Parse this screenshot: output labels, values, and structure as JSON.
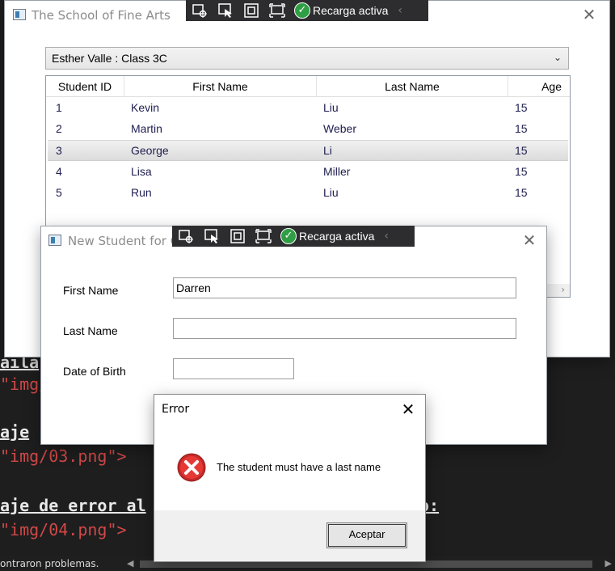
{
  "background_editor": {
    "lines": [
      {
        "text": "aila",
        "kind": "heading"
      },
      {
        "text": "\"img/",
        "kind": "string"
      },
      {
        "text": "aje",
        "kind": "heading"
      },
      {
        "text": "\"img/03.png\">",
        "kind": "string"
      },
      {
        "text": "aje de error al",
        "kind": "heading"
      },
      {
        "text": "o:",
        "kind": "heading"
      },
      {
        "text": "\"img/04.png\">",
        "kind": "string"
      }
    ],
    "status_text": "ontraron problemas."
  },
  "debug_toolbar": {
    "label": "Recarga activa",
    "tools": [
      "select-element-icon",
      "pointer-icon",
      "frame-icon",
      "display-layout-icon"
    ],
    "accent": "#2f9e44"
  },
  "main_window": {
    "title": "The School of Fine Arts",
    "class_selector": {
      "value": "Esther Valle : Class 3C"
    },
    "grid": {
      "columns": [
        "Student ID",
        "First Name",
        "Last Name",
        "Age"
      ],
      "rows": [
        {
          "id": "1",
          "first": "Kevin",
          "last": "Liu",
          "age": "15",
          "selected": false
        },
        {
          "id": "2",
          "first": "Martin",
          "last": "Weber",
          "age": "15",
          "selected": false
        },
        {
          "id": "3",
          "first": "George",
          "last": "Li",
          "age": "15",
          "selected": true
        },
        {
          "id": "4",
          "first": "Lisa",
          "last": "Miller",
          "age": "15",
          "selected": false
        },
        {
          "id": "5",
          "first": "Run",
          "last": "Liu",
          "age": "15",
          "selected": false
        }
      ]
    }
  },
  "new_student_window": {
    "title": "New Student for Cla",
    "fields": {
      "first_name": {
        "label": "First Name",
        "value": "Darren"
      },
      "last_name": {
        "label": "Last Name",
        "value": ""
      },
      "dob": {
        "label": "Date of Birth",
        "value": ""
      }
    }
  },
  "error_dialog": {
    "title": "Error",
    "message": "The student must have a last name",
    "ok_label": "Aceptar",
    "icon": "error-icon",
    "icon_color": "#d32f2f"
  }
}
